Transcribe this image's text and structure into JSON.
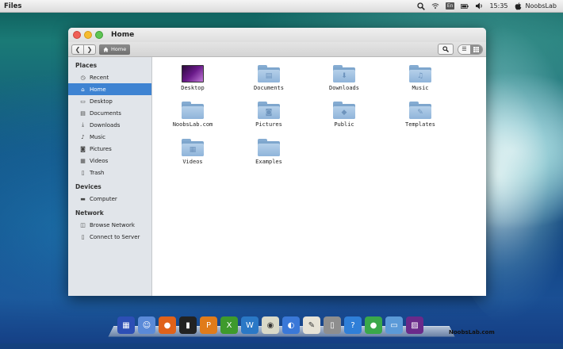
{
  "menubar": {
    "app_name": "Files",
    "tray": {
      "search_icon": "magnifier",
      "wifi_icon": "wifi",
      "language": "En",
      "battery_icon": "battery",
      "volume_icon": "speaker",
      "time": "15:35",
      "user": "NoobsLab"
    }
  },
  "window": {
    "title": "Home",
    "breadcrumb": "Home",
    "view_mode": "grid"
  },
  "sidebar": {
    "sections": [
      {
        "header": "Places",
        "items": [
          {
            "label": "Recent",
            "icon": "clock"
          },
          {
            "label": "Home",
            "icon": "home",
            "active": true
          },
          {
            "label": "Desktop",
            "icon": "desktop"
          },
          {
            "label": "Documents",
            "icon": "document"
          },
          {
            "label": "Downloads",
            "icon": "download"
          },
          {
            "label": "Music",
            "icon": "music"
          },
          {
            "label": "Pictures",
            "icon": "camera"
          },
          {
            "label": "Videos",
            "icon": "film"
          },
          {
            "label": "Trash",
            "icon": "trash"
          }
        ]
      },
      {
        "header": "Devices",
        "items": [
          {
            "label": "Computer",
            "icon": "drive"
          }
        ]
      },
      {
        "header": "Network",
        "items": [
          {
            "label": "Browse Network",
            "icon": "network"
          },
          {
            "label": "Connect to Server",
            "icon": "server"
          }
        ]
      }
    ]
  },
  "files": [
    {
      "name": "Desktop",
      "icon": "desktop-thumbnail"
    },
    {
      "name": "Documents",
      "icon": "folder-documents"
    },
    {
      "name": "Downloads",
      "icon": "folder-downloads"
    },
    {
      "name": "Music",
      "icon": "folder-music"
    },
    {
      "name": "NoobsLab.com",
      "icon": "folder"
    },
    {
      "name": "Pictures",
      "icon": "folder-pictures"
    },
    {
      "name": "Public",
      "icon": "folder-public"
    },
    {
      "name": "Templates",
      "icon": "folder-templates"
    },
    {
      "name": "Videos",
      "icon": "folder-videos"
    },
    {
      "name": "Examples",
      "icon": "folder"
    }
  ],
  "dock": {
    "apps": [
      "launcher",
      "finder",
      "firefox",
      "terminal",
      "office-presentation",
      "office-spreadsheet",
      "office-writer",
      "speaker-app",
      "video-chat",
      "text-editor",
      "trash",
      "help",
      "media-player",
      "files",
      "desktop-preview"
    ]
  },
  "watermark": "NoobsLab.com"
}
